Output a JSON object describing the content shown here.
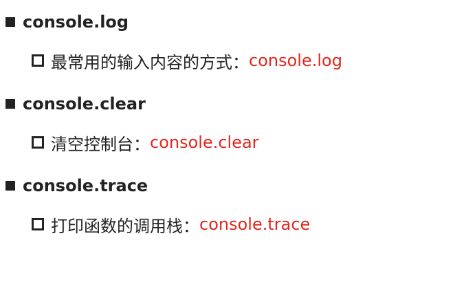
{
  "colors": {
    "text": "#222222",
    "accent": "#e3261c",
    "background": "#ffffff"
  },
  "sections": [
    {
      "heading": "console.log",
      "description": "最常用的输入内容的方式：",
      "code": "console.log"
    },
    {
      "heading": "console.clear",
      "description": "清空控制台：",
      "code": "console.clear"
    },
    {
      "heading": "console.trace",
      "description": "打印函数的调用栈：",
      "code": "console.trace"
    }
  ]
}
